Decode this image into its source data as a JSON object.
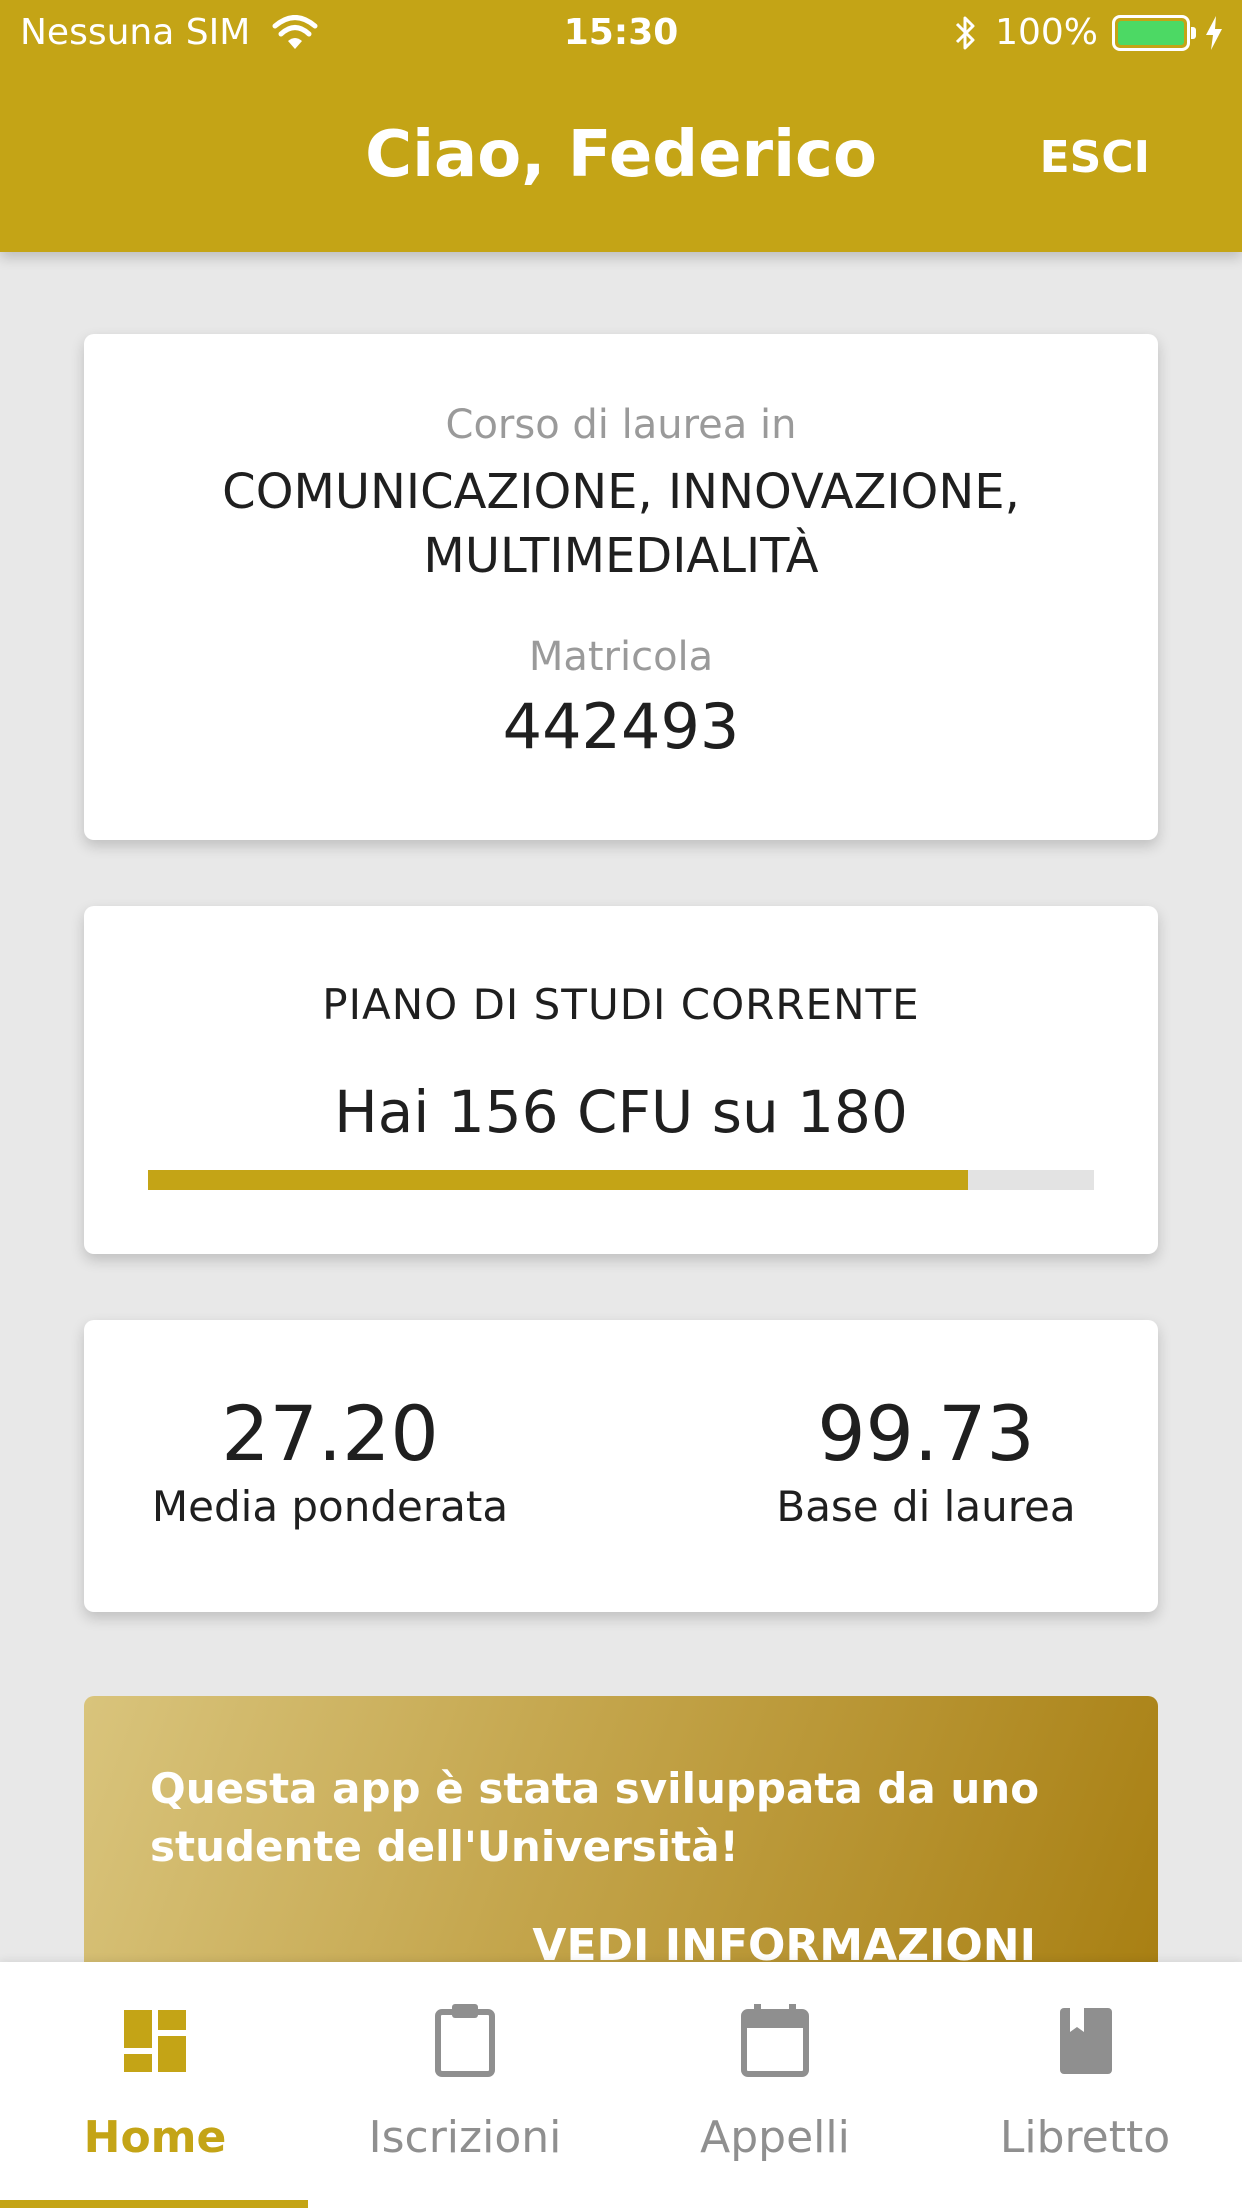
{
  "status_bar": {
    "carrier": "Nessuna SIM",
    "time": "15:30",
    "battery": "100%",
    "icons": [
      "wifi-icon",
      "bluetooth-icon",
      "battery-icon",
      "charging-icon"
    ]
  },
  "app_bar": {
    "title": "Ciao, Federico",
    "logout_label": "ESCI"
  },
  "degree_card": {
    "course_label": "Corso di laurea in",
    "course_name": "COMUNICAZIONE, INNOVAZIONE, MULTIMEDIALITÀ",
    "matricola_label": "Matricola",
    "matricola_value": "442493"
  },
  "plan_card": {
    "title": "PIANO DI STUDI CORRENTE",
    "cfu_text": "Hai 156 CFU su 180",
    "cfu_earned": 156,
    "cfu_total": 180
  },
  "stats_card": {
    "weighted_average": "27.20",
    "weighted_average_label": "Media ponderata",
    "graduation_base": "99.73",
    "graduation_base_label": "Base di laurea"
  },
  "banner": {
    "text": "Questa app è stata sviluppata da uno studente dell'Università!",
    "link_label": "VEDI INFORMAZIONI"
  },
  "bottom_nav": {
    "items": [
      {
        "label": "Home",
        "icon": "dashboard-icon",
        "active": true
      },
      {
        "label": "Iscrizioni",
        "icon": "clipboard-icon",
        "active": false
      },
      {
        "label": "Appelli",
        "icon": "calendar-icon",
        "active": false
      },
      {
        "label": "Libretto",
        "icon": "book-icon",
        "active": false
      }
    ]
  },
  "colors": {
    "primary": "#c4a416",
    "inactive": "#8f8f8f",
    "background": "#e8e8e8",
    "battery": "#4cd964"
  }
}
